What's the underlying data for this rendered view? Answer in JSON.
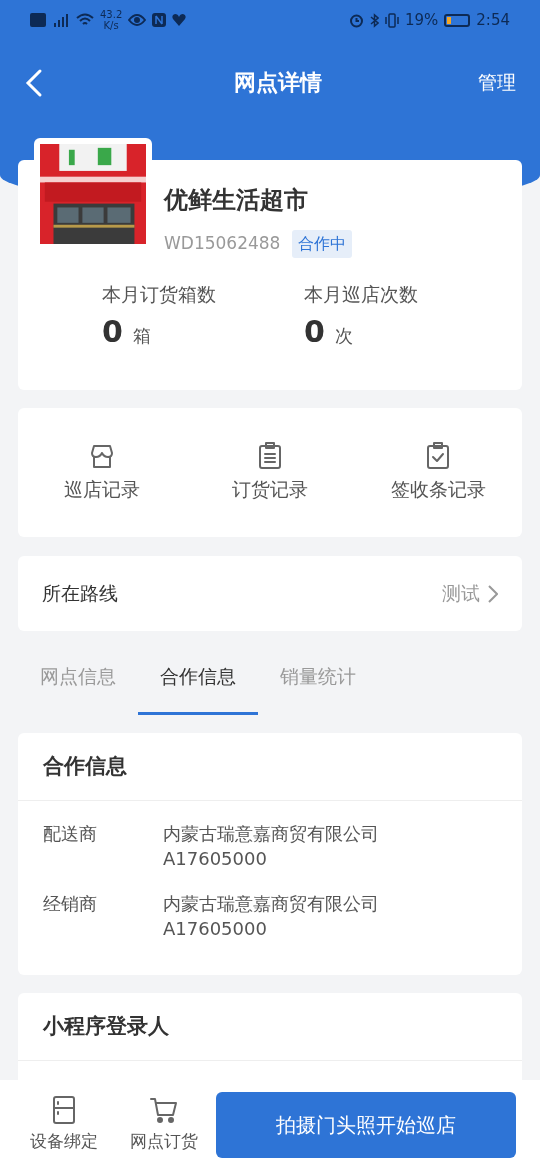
{
  "status_bar": {
    "speed": "43.2",
    "speed_unit": "K/s",
    "battery_text": "19%",
    "time": "2:54"
  },
  "nav": {
    "title": "网点详情",
    "action": "管理"
  },
  "store": {
    "name": "优鲜生活超市",
    "code": "WD15062488",
    "status": "合作中",
    "stats": [
      {
        "label": "本月订货箱数",
        "value": "0",
        "unit": "箱"
      },
      {
        "label": "本月巡店次数",
        "value": "0",
        "unit": "次"
      }
    ]
  },
  "shortcuts": [
    {
      "kind": "store",
      "label": "巡店记录"
    },
    {
      "kind": "list",
      "label": "订货记录"
    },
    {
      "kind": "check",
      "label": "签收条记录"
    }
  ],
  "route": {
    "label": "所在路线",
    "value": "测试"
  },
  "tabs": [
    {
      "label": "网点信息",
      "selected": false
    },
    {
      "label": "合作信息",
      "selected": true
    },
    {
      "label": "销量统计",
      "selected": false
    }
  ],
  "cooperation": {
    "title": "合作信息",
    "rows": [
      {
        "label": "配送商",
        "lines": [
          "内蒙古瑞意嘉商贸有限公司",
          "A17605000"
        ]
      },
      {
        "label": "经销商",
        "lines": [
          "内蒙古瑞意嘉商贸有限公司",
          "A17605000"
        ]
      }
    ]
  },
  "login_section": {
    "title": "小程序登录人"
  },
  "bottom_bar": {
    "items": [
      {
        "kind": "fridge",
        "label": "设备绑定"
      },
      {
        "kind": "cart",
        "label": "网点订货"
      }
    ],
    "primary": "拍摄门头照开始巡店"
  }
}
